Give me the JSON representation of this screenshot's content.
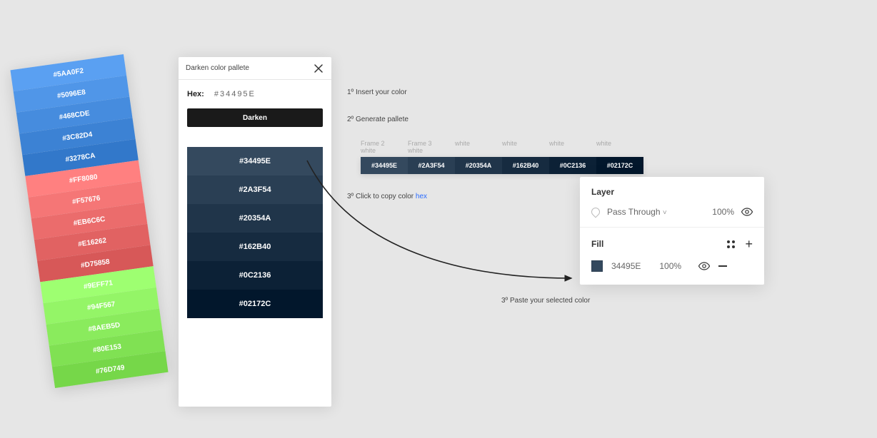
{
  "stacked_palette": [
    {
      "hex": "#5AA0F2"
    },
    {
      "hex": "#5096E8"
    },
    {
      "hex": "#468CDE"
    },
    {
      "hex": "#3C82D4"
    },
    {
      "hex": "#3278CA"
    },
    {
      "hex": "#FF8080"
    },
    {
      "hex": "#F57676"
    },
    {
      "hex": "#EB6C6C"
    },
    {
      "hex": "#E16262"
    },
    {
      "hex": "#D75858"
    },
    {
      "hex": "#9EFF71"
    },
    {
      "hex": "#94F567"
    },
    {
      "hex": "#8AEB5D"
    },
    {
      "hex": "#80E153"
    },
    {
      "hex": "#76D749"
    }
  ],
  "plugin": {
    "title": "Darken color pallete",
    "hex_label": "Hex:",
    "hex_value": "#34495E",
    "button_label": "Darken",
    "shades": [
      {
        "hex": "#34495E"
      },
      {
        "hex": "#2A3F54"
      },
      {
        "hex": "#20354A"
      },
      {
        "hex": "#162B40"
      },
      {
        "hex": "#0C2136"
      },
      {
        "hex": "#02172C"
      }
    ]
  },
  "steps": {
    "s1": "1º Insert your color",
    "s2": "2º Generate pallete",
    "s3_prefix": "3º Click to copy color ",
    "s3_link": "hex",
    "s4": "3º Paste your selected color"
  },
  "frames": {
    "headers": [
      {
        "top": "Frame 2",
        "bottom": "white"
      },
      {
        "top": "Frame 3",
        "bottom": "white"
      },
      {
        "top": "",
        "bottom": "white"
      },
      {
        "top": "",
        "bottom": "white"
      },
      {
        "top": "",
        "bottom": "white"
      },
      {
        "top": "",
        "bottom": "white"
      }
    ],
    "cells": [
      {
        "hex": "#34495E"
      },
      {
        "hex": "#2A3F54"
      },
      {
        "hex": "#20354A"
      },
      {
        "hex": "#162B40"
      },
      {
        "hex": "#0C2136"
      },
      {
        "hex": "#02172C"
      }
    ]
  },
  "layer_panel": {
    "layer_title": "Layer",
    "blend_mode": "Pass Through",
    "layer_opacity": "100%",
    "fill_title": "Fill",
    "fill_hex_display": "34495E",
    "fill_hex_color": "#34495E",
    "fill_opacity": "100%"
  }
}
